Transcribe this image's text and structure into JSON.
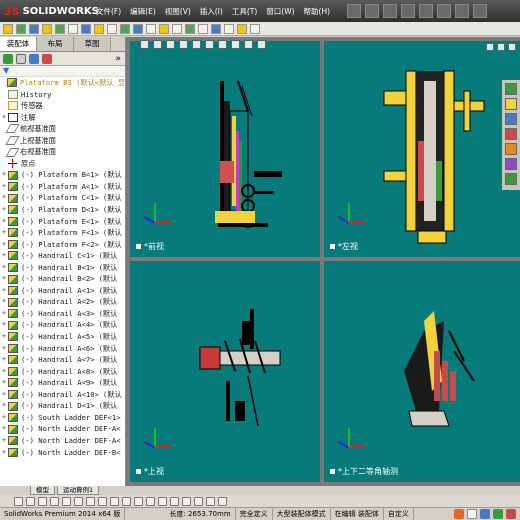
{
  "app": {
    "logo_prefix": "3S",
    "logo_text": "SOLIDWORKS"
  },
  "menu": [
    "文件(F)",
    "编辑(E)",
    "视图(V)",
    "插入(I)",
    "工具(T)",
    "窗口(W)",
    "帮助(H)"
  ],
  "panel": {
    "tabs": [
      "装配体",
      "布局",
      "草图"
    ],
    "more": "»"
  },
  "tree": {
    "root": "Plataform B3 (默认<默认_显",
    "items": [
      {
        "icon": "doc",
        "exp": "",
        "text": "History",
        "sfx": ""
      },
      {
        "icon": "sensor",
        "exp": "",
        "text": "传感器",
        "sfx": ""
      },
      {
        "icon": "ann",
        "exp": "+",
        "text": "注解",
        "sfx": ""
      },
      {
        "icon": "plane",
        "exp": "",
        "text": "前视基准面",
        "sfx": ""
      },
      {
        "icon": "plane",
        "exp": "",
        "text": "上视基准面",
        "sfx": ""
      },
      {
        "icon": "plane",
        "exp": "",
        "text": "右视基准面",
        "sfx": ""
      },
      {
        "icon": "origin",
        "exp": "",
        "text": "原点",
        "sfx": ""
      },
      {
        "icon": "asm",
        "exp": "+",
        "text": "(-) Plataform B<1>",
        "sfx": "(默认"
      },
      {
        "icon": "asm",
        "exp": "+",
        "text": "(-) Plataform A<1>",
        "sfx": "(默认"
      },
      {
        "icon": "asm",
        "exp": "+",
        "text": "(-) Plataform C<1>",
        "sfx": "(默认"
      },
      {
        "icon": "asm",
        "exp": "+",
        "text": "(-) Plataform D<1>",
        "sfx": "(默认"
      },
      {
        "icon": "asm",
        "exp": "+",
        "text": "(-) Plataform E<1>",
        "sfx": "(默认"
      },
      {
        "icon": "asm",
        "exp": "+",
        "text": "(-) Plataform F<1>",
        "sfx": "(默认"
      },
      {
        "icon": "asm",
        "exp": "+",
        "text": "(-) Plataform F<2>",
        "sfx": "(默认"
      },
      {
        "icon": "asm",
        "exp": "+",
        "text": "(-) Handrail C<1>",
        "sfx": "(默认"
      },
      {
        "icon": "asm",
        "exp": "+",
        "text": "(-) Handrail B<1>",
        "sfx": "(默认"
      },
      {
        "icon": "asm",
        "exp": "+",
        "text": "(-) Handrail B<2>",
        "sfx": "(默认"
      },
      {
        "icon": "asm",
        "exp": "+",
        "text": "(-) Handrail A<1>",
        "sfx": "(默认"
      },
      {
        "icon": "asm",
        "exp": "+",
        "text": "(-) Handrail A<2>",
        "sfx": "(默认"
      },
      {
        "icon": "asm",
        "exp": "+",
        "text": "(-) Handrail A<3>",
        "sfx": "(默认"
      },
      {
        "icon": "asm",
        "exp": "+",
        "text": "(-) Handrail A<4>",
        "sfx": "(默认"
      },
      {
        "icon": "asm",
        "exp": "+",
        "text": "(-) Handrail A<5>",
        "sfx": "(默认"
      },
      {
        "icon": "asm",
        "exp": "+",
        "text": "(-) Handrail A<6>",
        "sfx": "(默认"
      },
      {
        "icon": "asm",
        "exp": "+",
        "text": "(-) Handrail A<7>",
        "sfx": "(默认"
      },
      {
        "icon": "asm",
        "exp": "+",
        "text": "(-) Handrail A<8>",
        "sfx": "(默认"
      },
      {
        "icon": "asm",
        "exp": "+",
        "text": "(-) Handrail A<9>",
        "sfx": "(默认"
      },
      {
        "icon": "asm",
        "exp": "+",
        "text": "(-) Handrail A<10>",
        "sfx": "(默认"
      },
      {
        "icon": "asm",
        "exp": "+",
        "text": "(-) Handrail D<1>",
        "sfx": "(默认"
      },
      {
        "icon": "asm",
        "exp": "+",
        "text": "(-) South Ladder DEF<1>",
        "sfx": ""
      },
      {
        "icon": "asm",
        "exp": "+",
        "text": "(-) North Ladder DEF-A<",
        "sfx": ""
      },
      {
        "icon": "asm",
        "exp": "+",
        "text": "(-) North Ladder DEF-A<",
        "sfx": ""
      },
      {
        "icon": "asm",
        "exp": "+",
        "text": "(-) North Ladder DEF-B<",
        "sfx": ""
      }
    ]
  },
  "viewports": {
    "top_left": "*前视",
    "top_right": "*左视",
    "bottom_left": "*上视",
    "bottom_right": "*上下二等角轴测"
  },
  "bottom_tabs": [
    "模型",
    "运动算例1"
  ],
  "status": {
    "product": "SolidWorks Premium 2014 x64 版",
    "length": "长度: 2653.70mm",
    "state": "完全定义",
    "mode": "大型装配体模式",
    "editing": "在编辑 装配体",
    "custom": "自定义"
  },
  "colors": {
    "viewport_bg": "#067b79",
    "accent_yellow": "#f1d23a",
    "accent_green": "#3b9b3b"
  }
}
